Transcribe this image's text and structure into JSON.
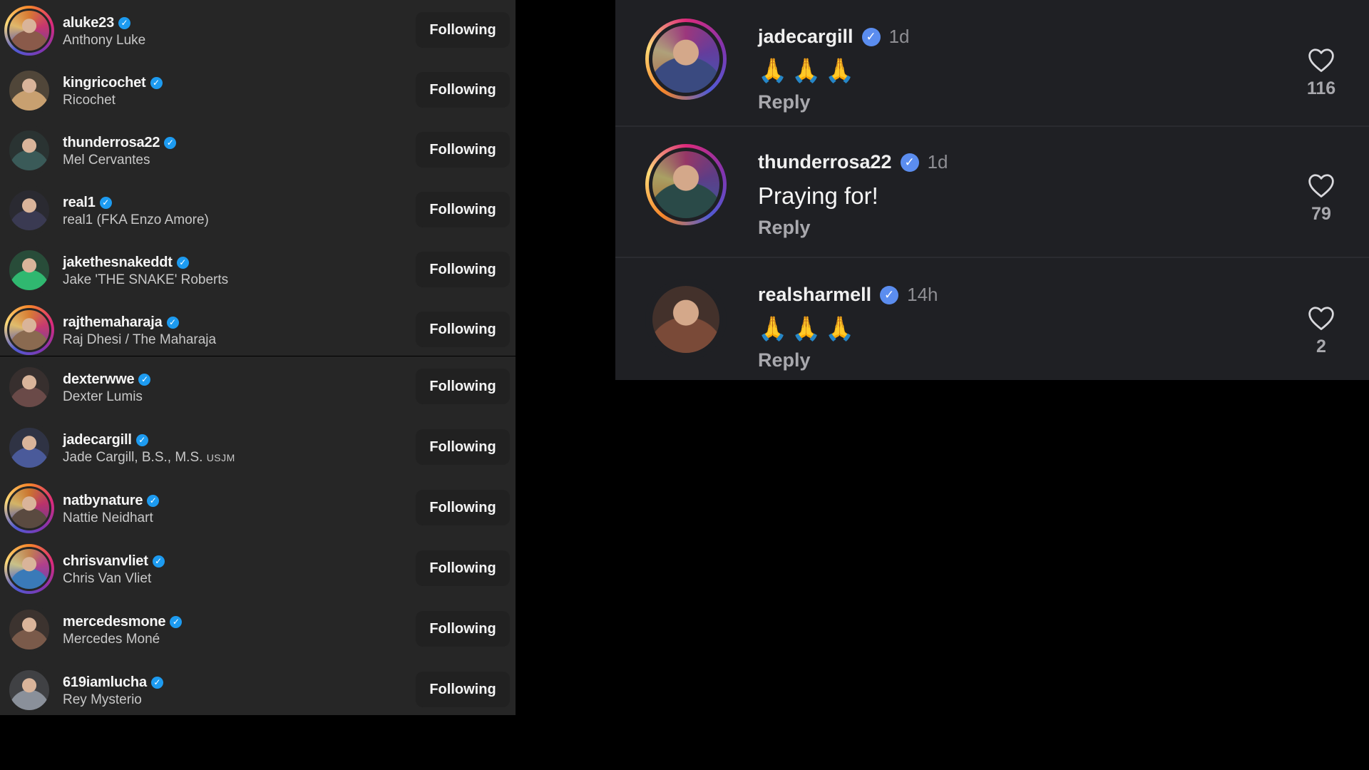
{
  "following": [
    {
      "handle": "aluke23",
      "name": "Anthony Luke",
      "button": "Following",
      "avatar_color": "#8a5a4a"
    },
    {
      "handle": "kingricochet",
      "name": "Ricochet",
      "button": "Following",
      "avatar_color": "#c8a070"
    },
    {
      "handle": "thunderrosa22",
      "name": "Mel Cervantes",
      "button": "Following",
      "avatar_color": "#3a5a58"
    },
    {
      "handle": "real1",
      "name": "real1 (FKA Enzo Amore)",
      "button": "Following",
      "avatar_color": "#3a3a52"
    },
    {
      "handle": "jakethesnakeddt",
      "name": "Jake 'THE SNAKE' Roberts",
      "button": "Following",
      "avatar_color": "#30b870"
    },
    {
      "handle": "rajthemaharaja",
      "name": "Raj Dhesi / The Maharaja",
      "button": "Following",
      "avatar_color": "#8a6a50"
    },
    {
      "handle": "dexterwwe",
      "name": "Dexter Lumis",
      "button": "Following",
      "avatar_color": "#6a4a48"
    },
    {
      "handle": "jadecargill",
      "name": "Jade Cargill, B.S., M.S.",
      "name_suffix": "USJM",
      "button": "Following",
      "avatar_color": "#4a5a9a"
    },
    {
      "handle": "natbynature",
      "name": "Nattie Neidhart",
      "button": "Following",
      "avatar_color": "#5a4a40"
    },
    {
      "handle": "chrisvanvliet",
      "name": "Chris Van Vliet",
      "button": "Following",
      "avatar_color": "#3a7ab8"
    },
    {
      "handle": "mercedesmone",
      "name": "Mercedes Moné",
      "button": "Following",
      "avatar_color": "#7a5a4a"
    },
    {
      "handle": "619iamlucha",
      "name": "Rey Mysterio",
      "button": "Following",
      "avatar_color": "#8a909a"
    }
  ],
  "comments": [
    {
      "handle": "jadecargill",
      "time": "1d",
      "text": "🙏🙏🙏",
      "reply": "Reply",
      "likes": "116",
      "avatar_color": "#3a4a80"
    },
    {
      "handle": "thunderrosa22",
      "time": "1d",
      "text": "Praying for!",
      "reply": "Reply",
      "likes": "79",
      "avatar_color": "#2a4a48"
    },
    {
      "handle": "realsharmell",
      "time": "14h",
      "text": "🙏🙏🙏",
      "reply": "Reply",
      "likes": "2",
      "avatar_color": "#7a4a38"
    }
  ],
  "icons": {
    "verified": "verified-badge-icon",
    "like": "heart-icon"
  },
  "colors": {
    "verified": "#1d9bf0",
    "verified_comment": "#5b8def",
    "panel": "#262626",
    "comments_panel": "#1f2024"
  }
}
